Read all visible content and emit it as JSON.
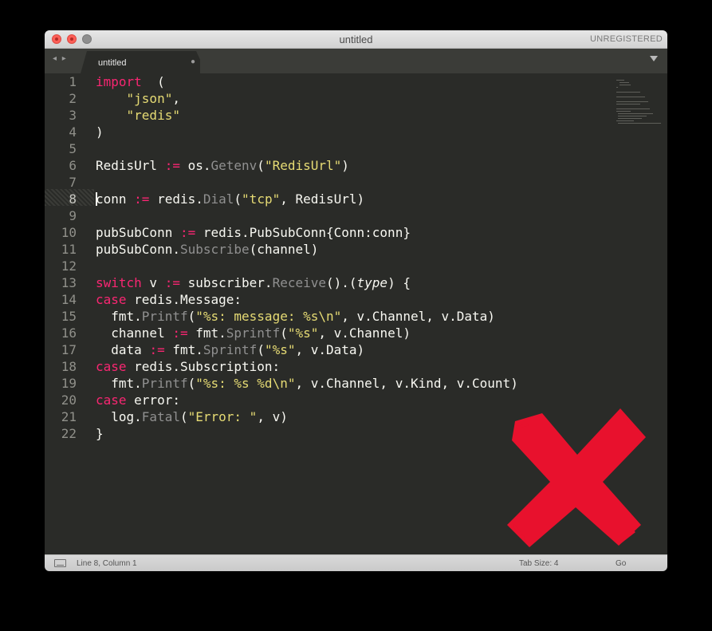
{
  "window": {
    "title": "untitled",
    "registration_label": "UNREGISTERED"
  },
  "tabs": [
    {
      "label": "untitled",
      "active": true
    }
  ],
  "nav_arrows": "◂ ▸",
  "editor": {
    "current_line": 8,
    "line_numbers": [
      "1",
      "2",
      "3",
      "4",
      "5",
      "6",
      "7",
      "8",
      "9",
      "10",
      "11",
      "12",
      "13",
      "14",
      "15",
      "16",
      "17",
      "18",
      "19",
      "20",
      "21",
      "22"
    ],
    "lines": [
      [
        [
          "kw",
          "import"
        ],
        [
          "",
          "  ("
        ]
      ],
      [
        [
          "",
          "    "
        ],
        [
          "st",
          "\"json\""
        ],
        [
          "",
          ","
        ]
      ],
      [
        [
          "",
          "    "
        ],
        [
          "st",
          "\"redis\""
        ]
      ],
      [
        [
          "",
          ")"
        ]
      ],
      [],
      [
        [
          "",
          "RedisUrl "
        ],
        [
          "op",
          ":="
        ],
        [
          "",
          ". os."
        ],
        [
          "fnc",
          "Getenv"
        ],
        [
          "",
          "("
        ],
        [
          "st",
          "\"RedisUrl\""
        ],
        [
          "",
          ")"
        ]
      ],
      [],
      [
        [
          "caret",
          ""
        ],
        [
          "",
          "conn "
        ],
        [
          "op",
          ":="
        ],
        [
          "",
          ". redis."
        ],
        [
          "fnc",
          "Dial"
        ],
        [
          "",
          "("
        ],
        [
          "st",
          "\"tcp\""
        ],
        [
          "",
          ", RedisUrl)"
        ]
      ],
      [],
      [
        [
          "",
          "pubSubConn "
        ],
        [
          "op",
          ":="
        ],
        [
          "",
          ". redis.PubSubConn{Conn:conn}"
        ]
      ],
      [
        [
          "",
          "pubSubConn."
        ],
        [
          "fnc",
          "Subscribe"
        ],
        [
          "",
          "(channel)"
        ]
      ],
      [],
      [
        [
          "kw",
          "switch"
        ],
        [
          "",
          " v "
        ],
        [
          "op",
          ":="
        ],
        [
          "",
          ". subscriber."
        ],
        [
          "fnc",
          "Receive"
        ],
        [
          "",
          "().("
        ],
        [
          "ty",
          "type"
        ],
        [
          "",
          ") {"
        ]
      ],
      [
        [
          "kw",
          "case"
        ],
        [
          "",
          " redis.Message:"
        ]
      ],
      [
        [
          "",
          "  fmt."
        ],
        [
          "fnc",
          "Printf"
        ],
        [
          "",
          "("
        ],
        [
          "st",
          "\"%s: message: %s\\n\""
        ],
        [
          "",
          ", v.Channel, v.Data)"
        ]
      ],
      [
        [
          "",
          "  channel "
        ],
        [
          "op",
          ":="
        ],
        [
          "",
          ". fmt."
        ],
        [
          "fnc",
          "Sprintf"
        ],
        [
          "",
          "("
        ],
        [
          "st",
          "\"%s\""
        ],
        [
          "",
          ", v.Channel)"
        ]
      ],
      [
        [
          "",
          "  data "
        ],
        [
          "op",
          ":="
        ],
        [
          "",
          ". fmt."
        ],
        [
          "fnc",
          "Sprintf"
        ],
        [
          "",
          "("
        ],
        [
          "st",
          "\"%s\""
        ],
        [
          "",
          ", v.Data)"
        ]
      ],
      [
        [
          "kw",
          "case"
        ],
        [
          "",
          " redis.Subscription:"
        ]
      ],
      [
        [
          "",
          "  fmt."
        ],
        [
          "fnc",
          "Printf"
        ],
        [
          "",
          "("
        ],
        [
          "st",
          "\"%s: %s %d\\n\""
        ],
        [
          "",
          ", v.Channel, v.Kind, v.Count)"
        ]
      ],
      [
        [
          "kw",
          "case"
        ],
        [
          "",
          " error:"
        ]
      ],
      [
        [
          "",
          "  log."
        ],
        [
          "fnc",
          "Fatal"
        ],
        [
          "",
          "("
        ],
        [
          "st",
          "\"Error: \""
        ],
        [
          "",
          ", v)"
        ]
      ],
      [
        [
          "",
          "}"
        ]
      ]
    ]
  },
  "statusbar": {
    "position": "Line 8, Column 1",
    "tab_size": "Tab Size: 4",
    "syntax": "Go"
  },
  "colors": {
    "editor_bg": "#2a2b28",
    "keyword": "#f92672",
    "string": "#e6db74",
    "x_mark": "#e8112d"
  },
  "overlay_icon": "red-x-mark-icon"
}
